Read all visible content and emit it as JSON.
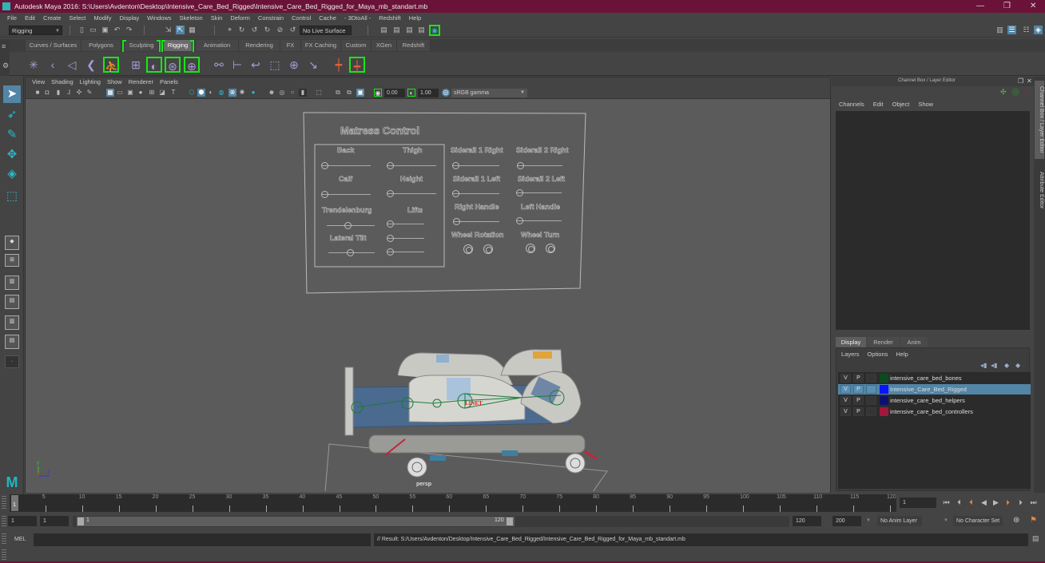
{
  "window": {
    "title": "Autodesk Maya 2016: S:\\Users\\Avdenton\\Desktop\\Intensive_Care_Bed_Rigged\\Intensive_Care_Bed_Rigged_for_Maya_mb_standart.mb",
    "controls": {
      "minimize": "—",
      "maximize": "❐",
      "close": "✕"
    }
  },
  "menubar": [
    "File",
    "Edit",
    "Create",
    "Select",
    "Modify",
    "Display",
    "Windows",
    "Skeleton",
    "Skin",
    "Deform",
    "Constrain",
    "Control",
    "Cache",
    "- 3DtoAll -",
    "Redshift",
    "Help"
  ],
  "statusline": {
    "mode_selector": "Rigging",
    "live_surface": "No Live Surface"
  },
  "shelf": {
    "tabs": [
      "Curves / Surfaces",
      "Polygons",
      "Sculpting",
      "Rigging",
      "Animation",
      "Rendering",
      "FX",
      "FX Caching",
      "Custom",
      "XGen",
      "Redshift"
    ],
    "active_tab": "Rigging"
  },
  "viewport": {
    "menu": [
      "View",
      "Shading",
      "Lighting",
      "Show",
      "Renderer",
      "Panels"
    ],
    "exposure": "0.00",
    "gamma": "1.00",
    "color_space": "sRGB gamma",
    "camera_label": "persp",
    "axis": {
      "y": "y",
      "z": "z"
    }
  },
  "control_panel": {
    "title": "Matress Control",
    "left_group": {
      "labels": [
        "Back",
        "Thigh",
        "Calf",
        "Height",
        "Trendelenburg",
        "Lifts",
        "Lateral Tilt"
      ]
    },
    "right_group": {
      "labels": [
        "Siderail 1 Right",
        "Siderail 2 Right",
        "Siderail 1 Left",
        "Siderail 2 Left",
        "Right Handle",
        "Left Handle",
        "Wheel Rotation",
        "Wheel Turn"
      ]
    }
  },
  "channel_box": {
    "title": "Channel Box / Layer Editor",
    "menu": [
      "Channels",
      "Edit",
      "Object",
      "Show"
    ]
  },
  "layer_editor": {
    "tabs": [
      "Display",
      "Render",
      "Anim"
    ],
    "active_tab": "Display",
    "menu": [
      "Layers",
      "Options",
      "Help"
    ],
    "layers": [
      {
        "v": "V",
        "p": "P",
        "color": "#0b4a1e",
        "name": "intensive_care_bed_bones",
        "selected": false
      },
      {
        "v": "V",
        "p": "P",
        "color": "#0a14ff",
        "name": "Intensive_Care_Bed_Rigged",
        "selected": true
      },
      {
        "v": "V",
        "p": "P",
        "color": "#0c1170",
        "name": "intensive_care_bed_helpers",
        "selected": false
      },
      {
        "v": "V",
        "p": "P",
        "color": "#a3173b",
        "name": "intensive_care_bed_controllers",
        "selected": false
      }
    ]
  },
  "side_tabs": [
    "Channel Box / Layer Editor",
    "Attribute Editor"
  ],
  "timeline": {
    "ticks": [
      "5",
      "10",
      "15",
      "20",
      "25",
      "30",
      "35",
      "40",
      "45",
      "50",
      "55",
      "60",
      "65",
      "70",
      "75",
      "80",
      "85",
      "90",
      "95",
      "100",
      "105",
      "110",
      "115",
      "120"
    ],
    "current_frame_marker": "1",
    "current_frame": "1"
  },
  "range": {
    "start": "1",
    "playback_start": "1",
    "slider_start": "1",
    "slider_end": "120",
    "playback_end": "120",
    "end": "200",
    "anim_layer": "No Anim Layer",
    "character_set": "No Character Set"
  },
  "command_line": {
    "label": "MEL",
    "input": "",
    "result": "// Result: S:/Users/Avdenton/Desktop/Intensive_Care_Bed_Rigged/Intensive_Care_Bed_Rigged_for_Maya_mb_standart.mb"
  },
  "colors": {
    "titlebar": "#6b1238",
    "accent": "#5285a6",
    "maya_teal": "#2bb8c9",
    "shelf_highlight": "#19e619"
  }
}
